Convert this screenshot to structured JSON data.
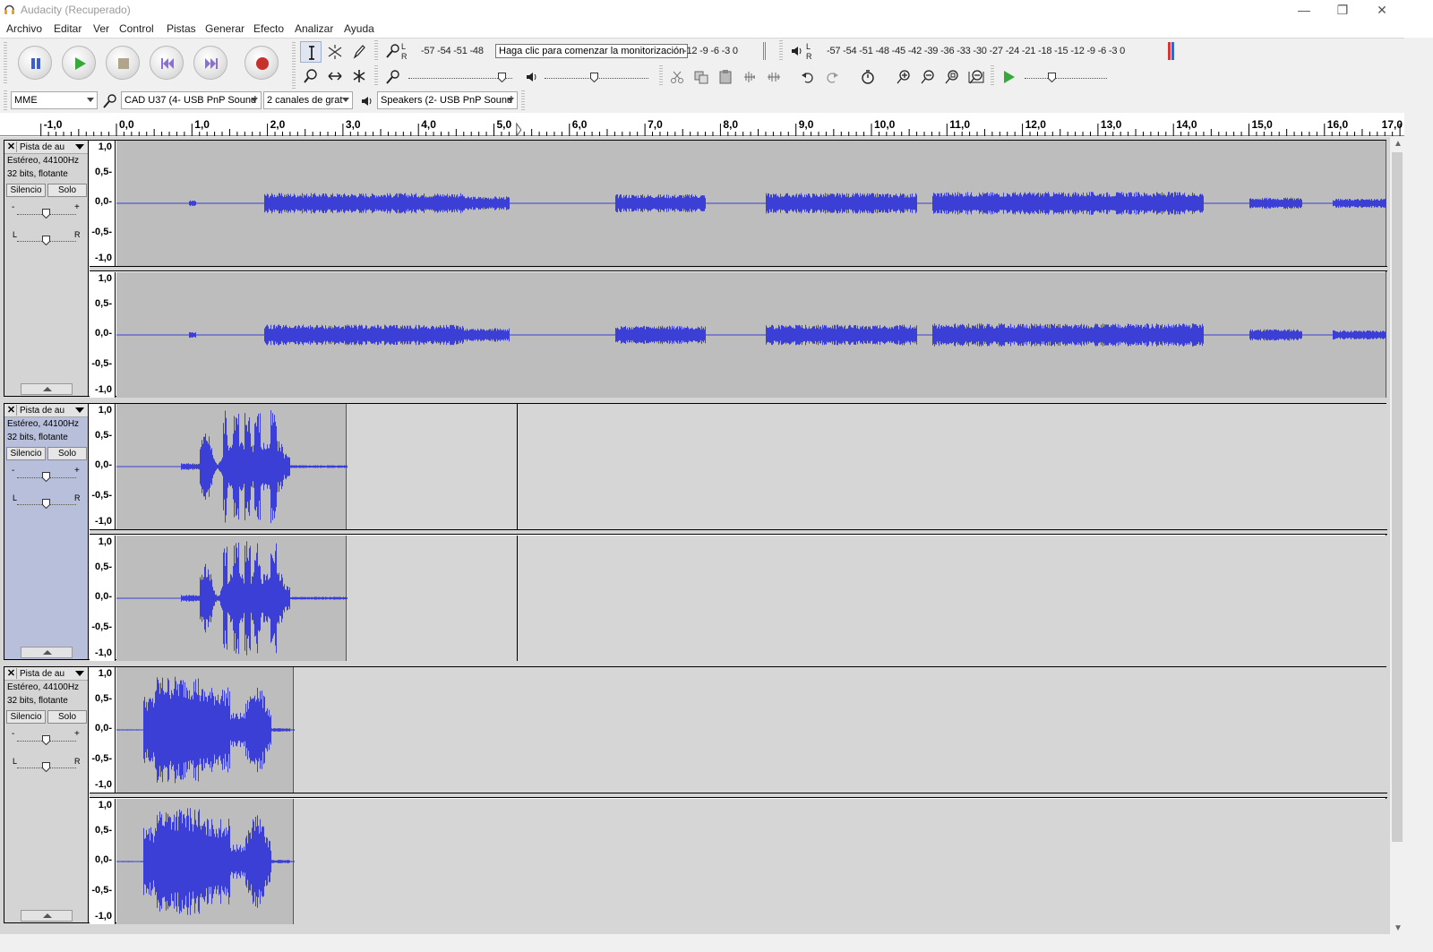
{
  "window": {
    "title": "Audacity (Recuperado)",
    "minimize": "—",
    "restore": "❐",
    "close": "✕"
  },
  "menu": [
    "Archivo",
    "Editar",
    "Ver",
    "Control",
    "Pistas",
    "Generar",
    "Efecto",
    "Analizar",
    "Ayuda"
  ],
  "meters": {
    "record_scale_a": "-57 -54 -51 -48",
    "record_scale_b": "-12  -9  -6  -3  0",
    "record_tooltip": "Haga clic para comenzar la monitorización",
    "playback_scale": "-57 -54 -51 -48 -45 -42 -39 -36 -33 -30 -27 -24 -21 -18 -15 -12  -9  -6  -3  0",
    "lr_left": "L",
    "lr_right": "R"
  },
  "device": {
    "host": "MME",
    "input": "CAD U37 (4- USB PnP Sound",
    "channels": "2 canales de grat",
    "output": "Speakers (2- USB PnP Sound"
  },
  "ruler": {
    "labels": [
      "-1,0",
      "0,0",
      "1,0",
      "2,0",
      "3,0",
      "4,0",
      "5,0",
      "6,0",
      "7,0",
      "8,0",
      "9,0",
      "10,0",
      "11,0",
      "12,0",
      "13,0",
      "14,0",
      "15,0",
      "16,0",
      "17,0"
    ],
    "min": -1.0,
    "max": 17.0,
    "cursor": 5.3
  },
  "vscale": [
    "1,0",
    "0,5-",
    "0,0-",
    "-0,5-",
    "-1,0"
  ],
  "tracks": [
    {
      "name": "Pista de au",
      "format": "Estéreo, 44100Hz",
      "bits": "32 bits, flotante",
      "mute": "Silencio",
      "solo": "Solo",
      "clip_end": 17.0,
      "selected": false
    },
    {
      "name": "Pista de au",
      "format": "Estéreo, 44100Hz",
      "bits": "32 bits, flotante",
      "mute": "Silencio",
      "solo": "Solo",
      "clip_end": 3.05,
      "selected": true
    },
    {
      "name": "Pista de au",
      "format": "Estéreo, 44100Hz",
      "bits": "32 bits, flotante",
      "mute": "Silencio",
      "solo": "Solo",
      "clip_end": 2.35,
      "selected": false
    }
  ],
  "gain_minus": "-",
  "gain_plus": "+",
  "pan_left": "L",
  "pan_right": "R"
}
